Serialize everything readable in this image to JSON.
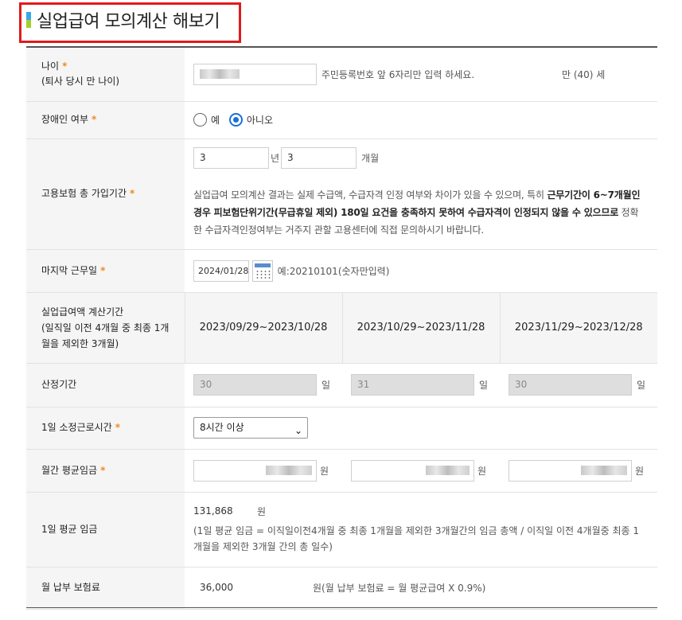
{
  "page": {
    "title": "실업급여 모의계산 해보기"
  },
  "colors": {
    "accent_red": "#e21a1a",
    "star": "#f08a1e",
    "radio_selected": "#1a6fdb"
  },
  "age": {
    "label": "나이",
    "sublabel": "(퇴사 당시 만 나이)",
    "hint": "주민등록번호 앞 6자리만 입력 하세요.",
    "result": "만 (40) 세"
  },
  "disability": {
    "label": "장애인 여부",
    "options": [
      "예",
      "아니오"
    ],
    "selected": "아니오"
  },
  "insurance_period": {
    "label": "고용보험 총 가입기간",
    "years": "3",
    "years_unit": "년",
    "months": "3",
    "months_unit": "개월",
    "notice_1": "실업급여 모의계산 결과는 실제 수급액, 수급자격 인정 여부와 차이가 있을 수 있으며, 특히 ",
    "notice_bold": "근무기간이 6~7개월인 경우 피보험단위기간(무급휴일 제외) 180일 요건을 충족하지 못하여 수급자격이 인정되지 않을 수 있으므로",
    "notice_2": " 정확한 수급자격인정여부는 거주지 관할 고용센터에 직접 문의하시기 바랍니다."
  },
  "last_work_day": {
    "label": "마지막 근무일",
    "value": "2024/01/28",
    "hint": "예:20210101(숫자만입력)"
  },
  "calc_period": {
    "label_line1": "실업급여액 계산기간",
    "label_line2": "(일직일 이전 4개월 중 최종 1개",
    "label_line3": "월을 제외한 3개월)",
    "periods": [
      "2023/09/29~2023/10/28",
      "2023/10/29~2023/11/28",
      "2023/11/29~2023/12/28"
    ]
  },
  "calc_days": {
    "label": "산정기간",
    "values": [
      "30",
      "31",
      "30"
    ],
    "unit": "일"
  },
  "daily_hours": {
    "label": "1일 소정근로시간",
    "selected": "8시간 이상"
  },
  "monthly_wage": {
    "label": "월간 평균임금",
    "unit": "원"
  },
  "daily_wage": {
    "label": "1일 평균 임금",
    "value": "131,868",
    "unit": "원",
    "formula": "(1일 평균 임금 = 이직일이전4개월 중 최종 1개월을 제외한 3개월간의 임금 총액 / 이직일 이전 4개월중 최종 1개월을 제외한 3개월 간의 총 일수)"
  },
  "premium": {
    "label": "월 납부 보험료",
    "value": "36,000",
    "note": "원(월 납부 보험료 = 월 평균급여 X 0.9%)"
  }
}
